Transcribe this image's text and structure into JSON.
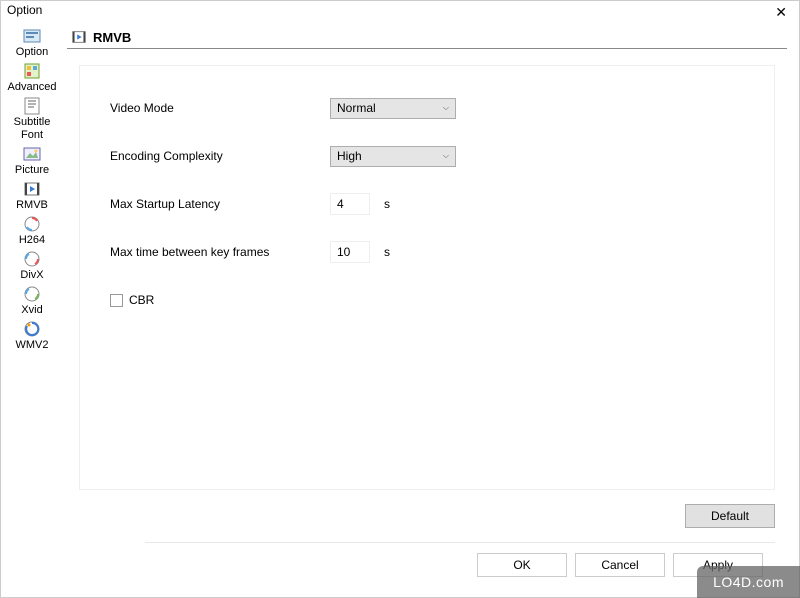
{
  "window": {
    "title": "Option"
  },
  "sidebar": {
    "items": [
      {
        "label": "Option",
        "icon": "option"
      },
      {
        "label": "Advanced",
        "icon": "advanced"
      },
      {
        "label": "Subtitle Font",
        "icon": "subtitle"
      },
      {
        "label": "Picture",
        "icon": "picture"
      },
      {
        "label": "RMVB",
        "icon": "rmvb"
      },
      {
        "label": "H264",
        "icon": "h264"
      },
      {
        "label": "DivX",
        "icon": "divx"
      },
      {
        "label": "Xvid",
        "icon": "xvid"
      },
      {
        "label": "WMV2",
        "icon": "wmv2"
      }
    ],
    "selected": "RMVB"
  },
  "section": {
    "title": "RMVB"
  },
  "form": {
    "video_mode": {
      "label": "Video Mode",
      "value": "Normal"
    },
    "encoding_complexity": {
      "label": "Encoding Complexity",
      "value": "High"
    },
    "max_startup_latency": {
      "label": "Max Startup Latency",
      "value": "4",
      "unit": "s"
    },
    "max_time_keyframes": {
      "label": "Max time between key frames",
      "value": "10",
      "unit": "s"
    },
    "cbr": {
      "label": "CBR",
      "checked": false
    }
  },
  "buttons": {
    "default": "Default",
    "ok": "OK",
    "cancel": "Cancel",
    "apply": "Apply"
  },
  "watermark": "LO4D.com"
}
